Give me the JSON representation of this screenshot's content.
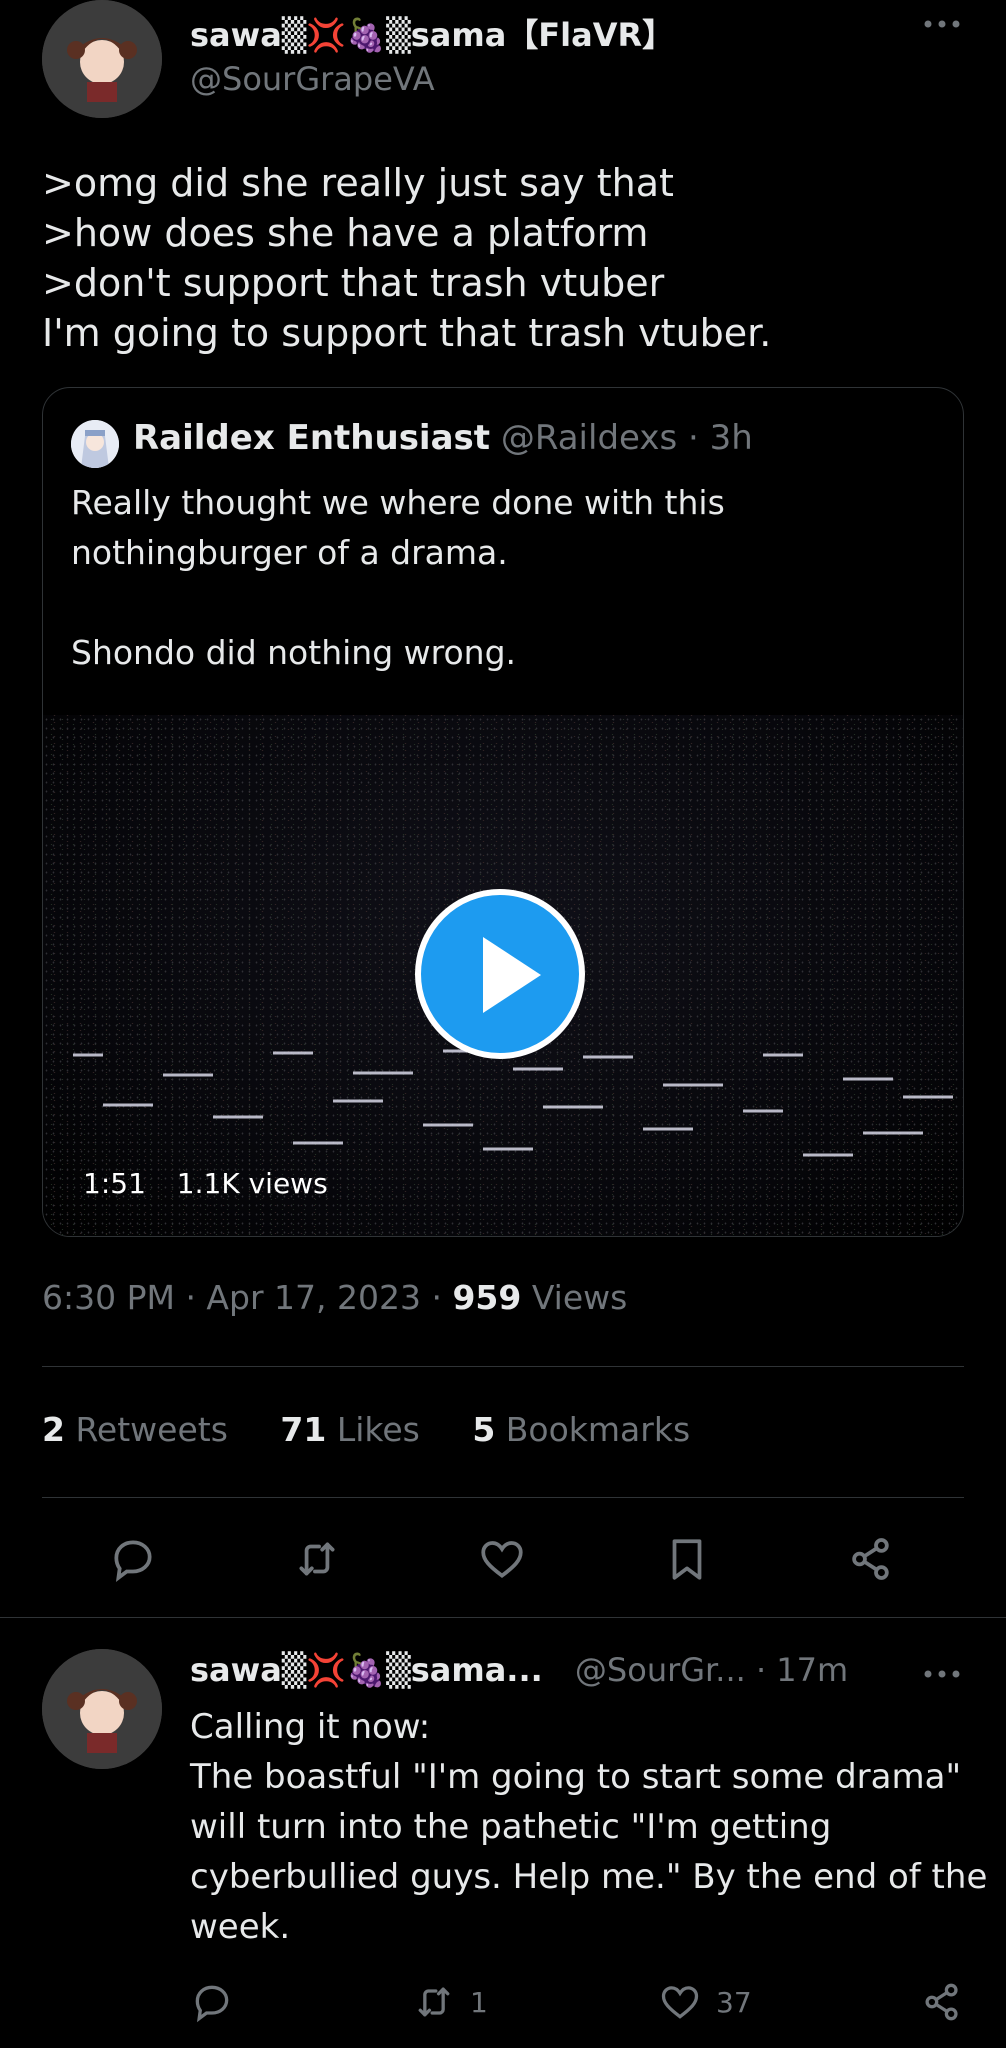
{
  "main_tweet": {
    "display_name": "sawa▒💢🍇▒sama【FlaVR】",
    "handle": "@SourGrapeVA",
    "body_lines": [
      ">omg did she really just say that",
      ">how does she have a platform",
      ">don't support that trash vtuber",
      "I'm going to support that trash vtuber."
    ],
    "timestamp": "6:30 PM · Apr 17, 2023 · ",
    "views_count": "959",
    "views_label": " Views"
  },
  "quoted_tweet": {
    "display_name": "Raildex Enthusiast",
    "handle": "@Raildexs",
    "time": "· 3h",
    "body_lines": [
      "Really thought we where done with this",
      "nothingburger of a drama.",
      "",
      "Shondo did nothing wrong."
    ],
    "video": {
      "duration": "1:51",
      "views": "1.1K views"
    }
  },
  "stats": {
    "retweets_count": "2",
    "retweets_label": "Retweets",
    "likes_count": "71",
    "likes_label": "Likes",
    "bookmarks_count": "5",
    "bookmarks_label": "Bookmarks"
  },
  "action_bar_icons": [
    "reply-icon",
    "retweet-icon",
    "like-icon",
    "bookmark-icon",
    "share-icon"
  ],
  "reply": {
    "display_name": "sawa▒💢🍇▒sama...",
    "handle": "@SourGr...",
    "time": "· 17m",
    "body_lines": [
      "Calling it now:",
      "The boastful \"I'm going to start some drama\"",
      "will turn into the pathetic \"I'm getting",
      "cyberbullied guys. Help me.\" By the end of the",
      "week."
    ],
    "retweet_count": "1",
    "like_count": "37"
  },
  "colors": {
    "background": "#000000",
    "text": "#e7e9ea",
    "muted": "#71767b",
    "accent": "#1d9bf0",
    "divider": "#2f3336"
  }
}
